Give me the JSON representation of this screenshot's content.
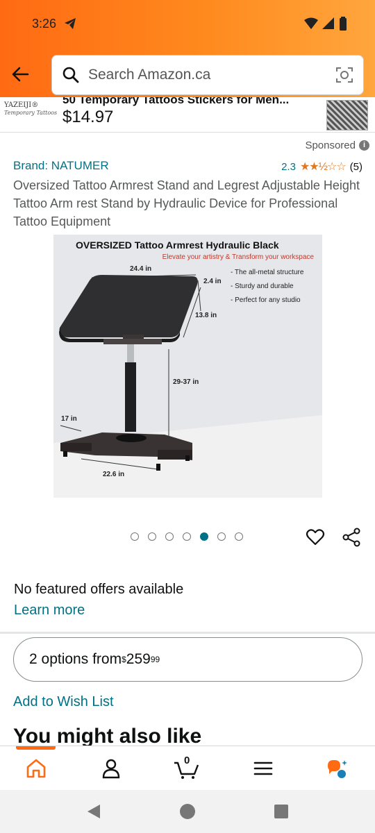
{
  "status": {
    "time": "3:26"
  },
  "search": {
    "placeholder": "Search Amazon.ca"
  },
  "ad": {
    "brand_logo": "YAZEIJI®",
    "brand_sub": "Temporary Tattoos",
    "title": "50 Temporary Tattoos Stickers for Men...",
    "price": "$14.97"
  },
  "sponsored_label": "Sponsored",
  "product": {
    "brand": "Brand: NATUMER",
    "rating_value": "2.3",
    "rating_stars": 2.5,
    "rating_count": "(5)",
    "title": "Oversized Tattoo Armrest Stand and Legrest Adjustable Height Tattoo Arm rest Stand by Hydraulic Device for Professional Tattoo Equipment",
    "image": {
      "headline": "OVERSIZED Tattoo Armrest Hydraulic Black",
      "subheadline": "Elevate your artistry & Transform your workspace",
      "features": [
        "- The all-metal structure",
        "- Sturdy and durable",
        "- Perfect for any studio"
      ],
      "dims": {
        "top_width": "24.4 in",
        "thickness": "2.4 in",
        "depth": "13.8 in",
        "height": "29-37 in",
        "base_depth": "17 in",
        "base_width": "22.6 in"
      }
    },
    "carousel": {
      "count": 7,
      "active_index": 4
    }
  },
  "offers": {
    "no_featured": "No featured offers available",
    "learn_more": "Learn more",
    "options_prefix": "2 options from ",
    "price_symbol": "$",
    "price_whole": "259",
    "price_cents": "99"
  },
  "wishlist_label": "Add to Wish List",
  "also_like": "You might also like",
  "bottom_nav": {
    "items": [
      "home-icon",
      "account-icon",
      "cart-icon",
      "menu-icon",
      "rufus-icon"
    ],
    "cart_count": "0",
    "accent": "#ff6a13"
  },
  "colors": {
    "link": "#007185",
    "star": "#de7921",
    "header_start": "#ff6a13",
    "header_end": "#ffa63d"
  }
}
